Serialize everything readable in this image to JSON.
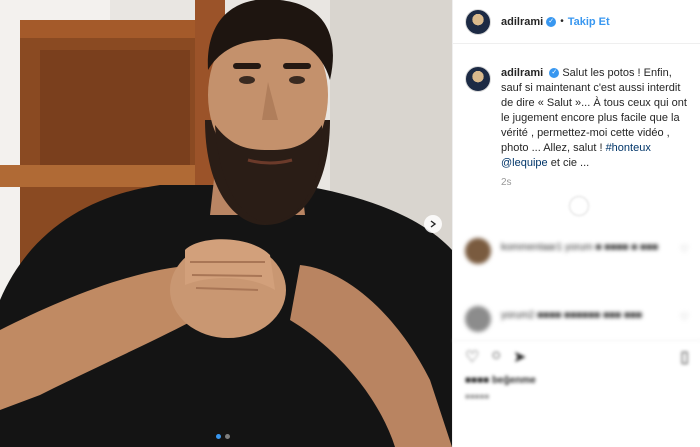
{
  "post": {
    "username": "adilrami",
    "follow_label": "Takip Et",
    "separator": "•",
    "caption_before": "Salut les potos ! Enfin, sauf si maintenant c'est aussi interdit de dire « Salut »... À tous ceux qui ont le jugement encore plus facile que la vérité , permettez-moi cette vidéo , photo ... Allez, salut ! ",
    "hashtag": "#honteux",
    "mention": "@lequipe",
    "caption_after": " et cie ...",
    "time_ago": "2s"
  },
  "media": {
    "dots": 2,
    "active_dot": 0,
    "next_icon": "chevron-right-icon"
  },
  "comments": [
    {
      "text": "kommentaar1 yorum ■ ■■■■ ■ ■■■",
      "avatar_color": "#7a5b3f"
    },
    {
      "text": "yorum2 ■■■■ ■■■■■■ ■■■ ■■■",
      "avatar_color": "#8c8c8c"
    }
  ],
  "actions": {
    "like_icon": "heart-icon",
    "comment_icon": "comment-icon",
    "share_icon": "share-icon",
    "save_icon": "bookmark-icon",
    "likes_text": "■■■■ beğenme",
    "date_text": "■■■■■"
  },
  "colors": {
    "link": "#003569",
    "accent": "#3897f0"
  }
}
